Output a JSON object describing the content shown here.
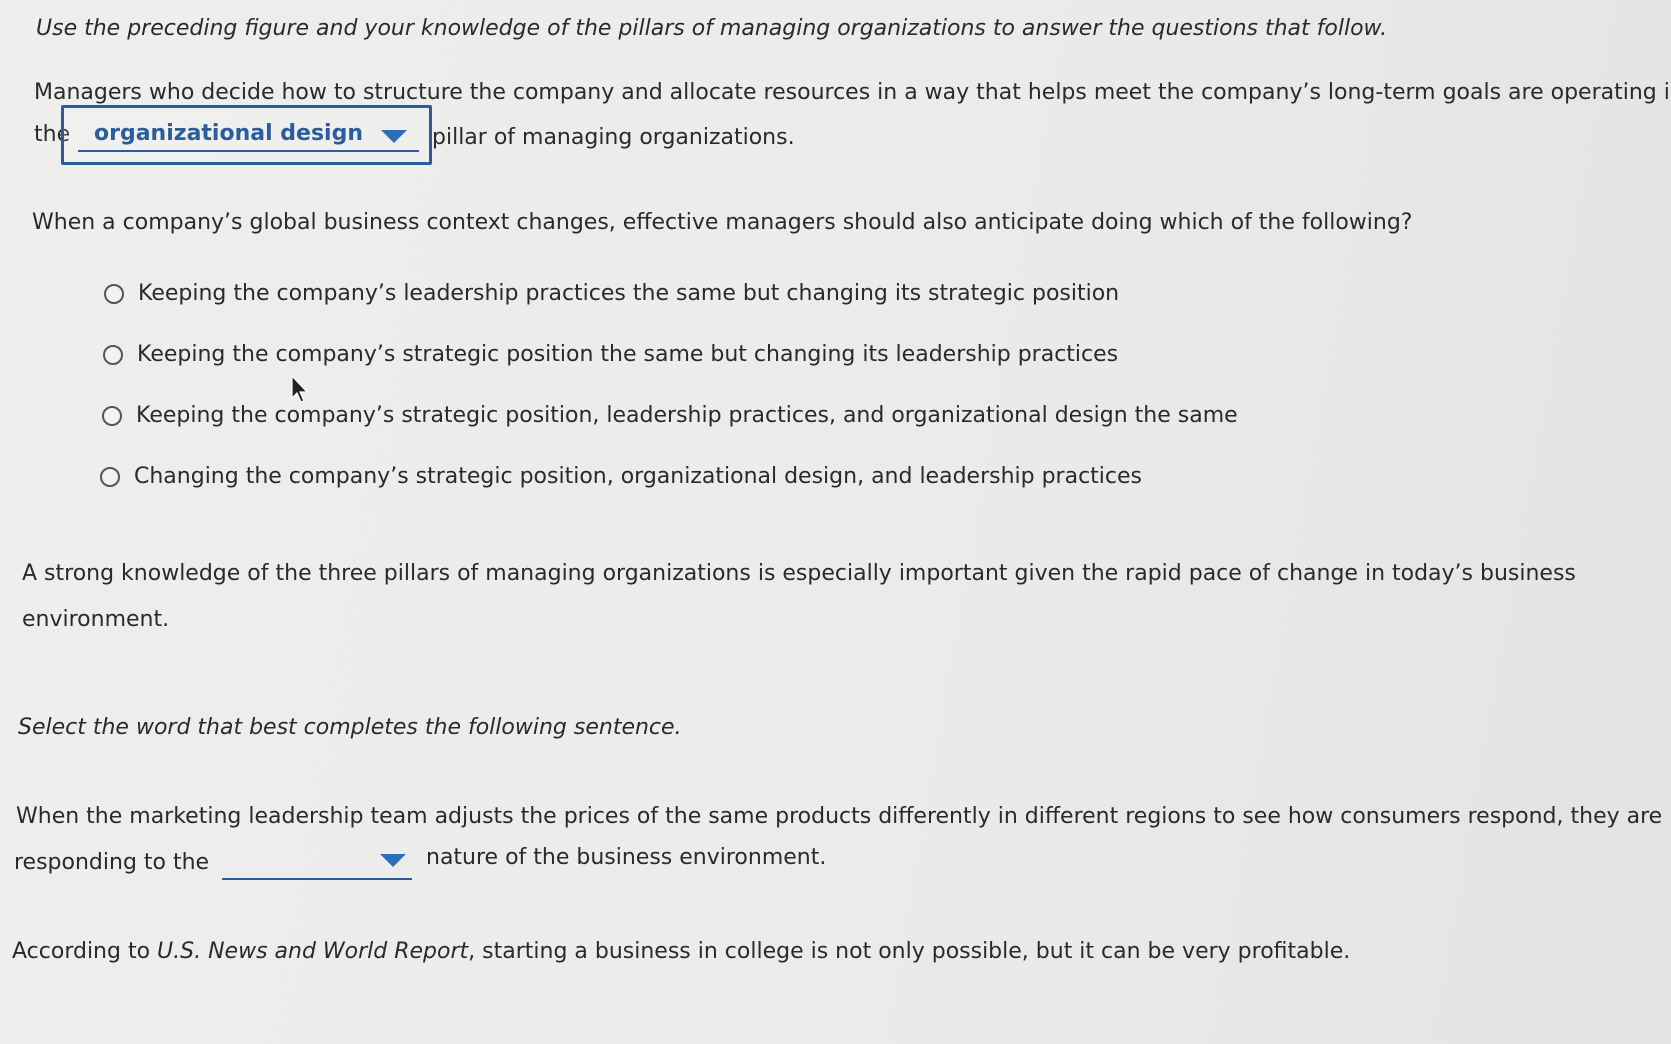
{
  "intro": "Use the preceding figure and your knowledge of the pillars of managing organizations to answer the questions that follow.",
  "q1": {
    "line1": "Managers who decide how to structure the company and allocate resources in a way that helps meet the company’s long-term goals are operating in",
    "prefix": "the",
    "selected": "organizational design",
    "suffix": "pillar of managing organizations."
  },
  "q2": {
    "prompt": "When a company’s global business context changes, effective managers should also anticipate doing which of the following?",
    "options": [
      "Keeping the company’s leadership practices the same but changing its strategic position",
      "Keeping the company’s strategic position the same but changing its leadership practices",
      "Keeping the company’s strategic position, leadership practices, and organizational design the same",
      "Changing the company’s strategic position, organizational design, and leadership practices"
    ]
  },
  "para": {
    "line1": "A strong knowledge of the three pillars of managing organizations is especially important given the rapid pace of change in today’s business",
    "line2": "environment."
  },
  "instruction": "Select the word that best completes the following sentence.",
  "q3": {
    "line1": "When the marketing leadership team adjusts the prices of the same products differently in different regions to see how consumers respond, they are",
    "prefix": "responding to the",
    "selected": "",
    "suffix": "nature of the business environment."
  },
  "closing": {
    "before": "According to ",
    "source": "U.S. News and World Report",
    "after": ", starting a business in college is not only possible, but it can be very profitable."
  },
  "colors": {
    "accent": "#2b5d9b",
    "caret": "#2b6fb8",
    "text": "#2a2a2a"
  }
}
